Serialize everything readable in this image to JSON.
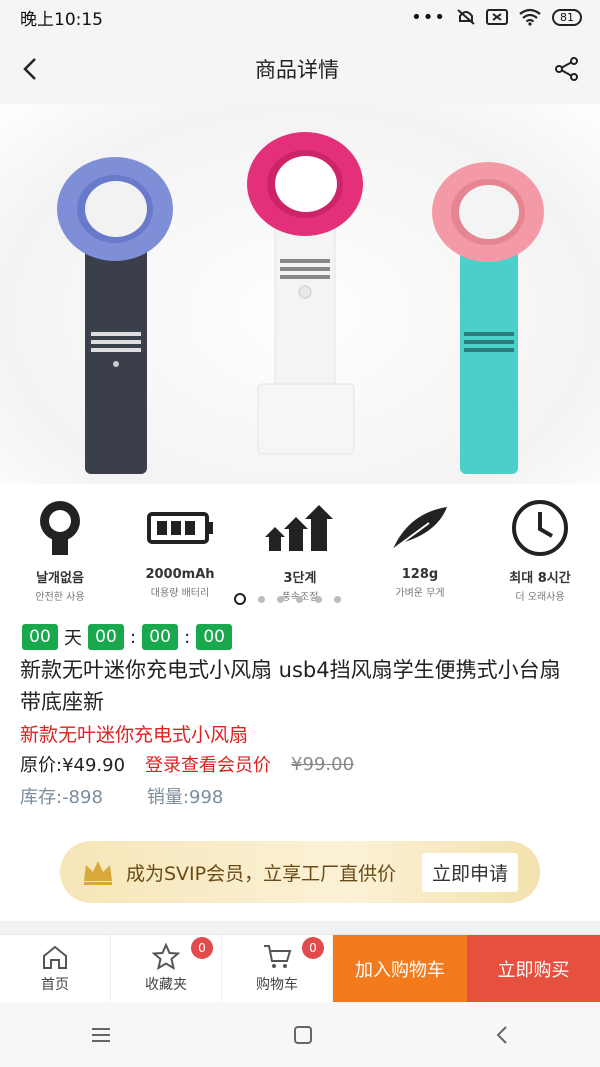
{
  "status_bar": {
    "time": "晚上10:15",
    "battery": "81"
  },
  "header": {
    "title": "商品详情"
  },
  "hero": {
    "features": [
      {
        "label": "날개없음",
        "sub": "안전한 사용"
      },
      {
        "label": "2000mAh",
        "sub": "대용량 배터리"
      },
      {
        "label": "3단계",
        "sub": "풍속조절"
      },
      {
        "label": "128g",
        "sub": "가벼운 무게"
      },
      {
        "label": "최대 8시간",
        "sub": "더 오래사용"
      }
    ],
    "active_slide": 1,
    "slide_count": 6
  },
  "countdown": {
    "days": "00",
    "day_label": "天",
    "hours": "00",
    "minutes": "00",
    "seconds": "00",
    "sep": ":"
  },
  "product": {
    "title": "新款无叶迷你充电式小风扇 usb4挡风扇学生便携式小台扇带底座新",
    "subtitle": "新款无叶迷你充电式小风扇",
    "price_label": "原价:¥49.90",
    "member_price": "登录查看会员价",
    "old_price": "¥99.00",
    "stock": "库存:-898",
    "sales": "销量:998"
  },
  "svip": {
    "text": "成为SVIP会员，立享工厂直供价",
    "button": "立即申请"
  },
  "tabbar": {
    "home": "首页",
    "favorites": "收藏夹",
    "favorites_badge": "0",
    "cart": "购物车",
    "cart_badge": "0",
    "add_to_cart": "加入购物车",
    "buy_now": "立即购买"
  },
  "colors": {
    "countdown_green": "#1aa84f",
    "accent_red": "#d22222",
    "cart_orange": "#f37b1d",
    "buy_red": "#e5503f"
  }
}
